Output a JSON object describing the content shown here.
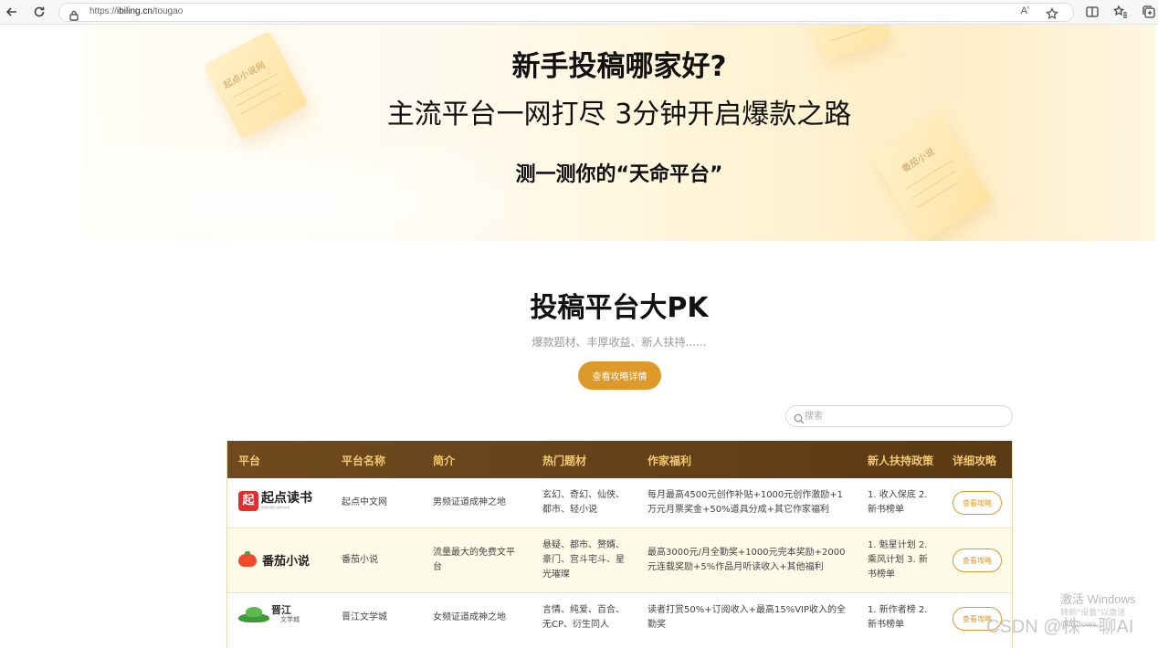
{
  "browser": {
    "url_prefix": "https://",
    "url_host": "ibiling.cn",
    "url_path": "/tougao",
    "read_aloud": "Aʹ"
  },
  "hero": {
    "title": "新手投稿哪家好?",
    "subtitle": "主流平台一网打尽 3分钟开启爆款之路",
    "test_prefix": "测一测你的",
    "test_highlight": "“天命平台”",
    "paper1_text": "起点小说网",
    "paper2_text": "番茄小说"
  },
  "pk": {
    "title": "投稿平台大PK",
    "subtitle": "爆款题材、丰厚收益、新人扶持......",
    "guide_button": "查看攻略详情",
    "search_placeholder": "搜索"
  },
  "table": {
    "headers": [
      "平台",
      "平台名称",
      "简介",
      "热门题材",
      "作家福利",
      "新人扶持政策",
      "详细攻略"
    ],
    "rows": [
      {
        "logo": "起点读书",
        "logo_tagline": "阅读有温度 创作有态度",
        "name": "起点中文网",
        "intro": "男频证道成神之地",
        "topics": "玄幻、奇幻、仙侠、都市、轻小说",
        "benefits": "每月最高4500元创作补贴+1000元创作激励+1万元月票奖金+50%道具分成+其它作家福利",
        "policy": "1. 收入保底 2. 新书榜单",
        "button": "查看攻略"
      },
      {
        "logo": "番茄小说",
        "logo_tagline": "",
        "name": "番茄小说",
        "intro": "流量最大的免费文平台",
        "topics": "悬疑、都市、赘婿、豪门、宫斗宅斗、星光璀璨",
        "benefits": "最高3000元/月全勤奖+1000元完本奖励+2000元连载奖励+5%作品月听读收入+其他福利",
        "policy": "1. 魁星计划 2. 乘风计划 3. 新书榜单",
        "button": "查看攻略"
      },
      {
        "logo": "晋江",
        "logo_tagline": "文学城",
        "name": "晋江文学城",
        "intro": "女频证道成神之地",
        "topics": "言情、纯爱、百合、无CP、衍生同人",
        "benefits": "读者打赏50%+订阅收入+最高15%VIP收入的全勤奖",
        "policy": "1. 新作者榜 2. 新书榜单",
        "button": "查看攻略"
      }
    ]
  },
  "watermarks": {
    "windows": "激活 Windows",
    "windows_sub": "转到\"设置\"以激活 Windows。",
    "csdn": "CSDN @株一聊AI"
  },
  "colors": {
    "accent": "#dd9a2a",
    "header_bg": "#6f4a1e",
    "header_text": "#f3c872",
    "qidian_red": "#e02d2d",
    "fanqie_red": "#f04a2e",
    "jjwxc_green": "#3f9b3a"
  }
}
